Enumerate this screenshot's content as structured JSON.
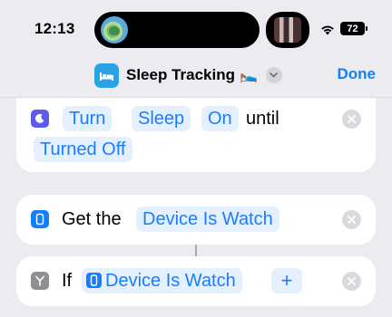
{
  "status_bar": {
    "time": "12:13",
    "battery": "72"
  },
  "nav": {
    "title": "Sleep Tracking",
    "title_emoji": "🛌",
    "done_label": "Done"
  },
  "actions": [
    {
      "icon": "moon-icon",
      "icon_color": "#5e5ce6",
      "parts": [
        "Turn",
        "Sleep",
        "On",
        "until",
        "Turned Off"
      ]
    },
    {
      "icon": "watch-icon",
      "icon_color": "#157efb",
      "parts": [
        "Get the",
        "Device Is Watch"
      ]
    },
    {
      "icon": "branch-icon",
      "icon_color": "#8e8e93",
      "parts": [
        "If",
        "Device Is Watch",
        "+"
      ]
    }
  ],
  "colors": {
    "accent": "#157efb",
    "token_bg": "#e4f0fd",
    "background": "#ebebf0"
  }
}
